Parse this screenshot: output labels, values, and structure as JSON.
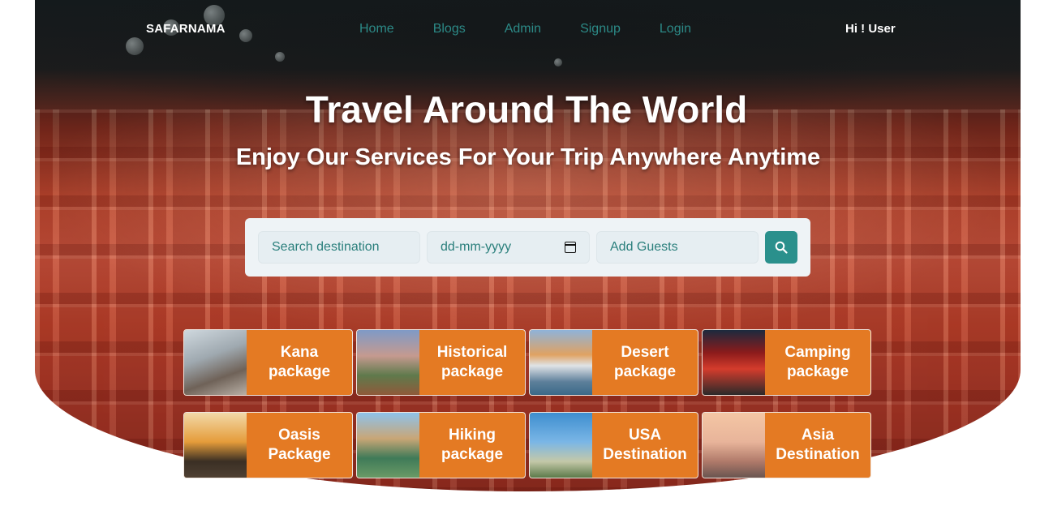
{
  "nav": {
    "brand": "SAFARNAMA",
    "links": [
      "Home",
      "Blogs",
      "Admin",
      "Signup",
      "Login"
    ],
    "greeting": "Hi ! User"
  },
  "hero": {
    "title": "Travel Around The World",
    "subtitle": "Enjoy Our Services For Your Trip Anywhere Anytime"
  },
  "search": {
    "destination_placeholder": "Search destination",
    "date_placeholder": "dd-mm-yyyy",
    "guests_placeholder": "Add Guests",
    "button_icon": "search-icon"
  },
  "packages": [
    {
      "label": "Kana package",
      "thumb": "eiffel-tower"
    },
    {
      "label": "Historical package",
      "thumb": "old-town-city"
    },
    {
      "label": "Desert package",
      "thumb": "memorial-lake"
    },
    {
      "label": "Camping package",
      "thumb": "chinatown-gate"
    },
    {
      "label": "Oasis Package",
      "thumb": "big-ben-sunset"
    },
    {
      "label": "Hiking package",
      "thumb": "temple-lake"
    },
    {
      "label": "USA Destination",
      "thumb": "capitol-plane"
    },
    {
      "label": "Asia Destination",
      "thumb": "riverside-city"
    }
  ],
  "colors": {
    "nav_link": "#2c8a87",
    "card_bg": "#e47a23",
    "search_button": "#2a908c"
  }
}
